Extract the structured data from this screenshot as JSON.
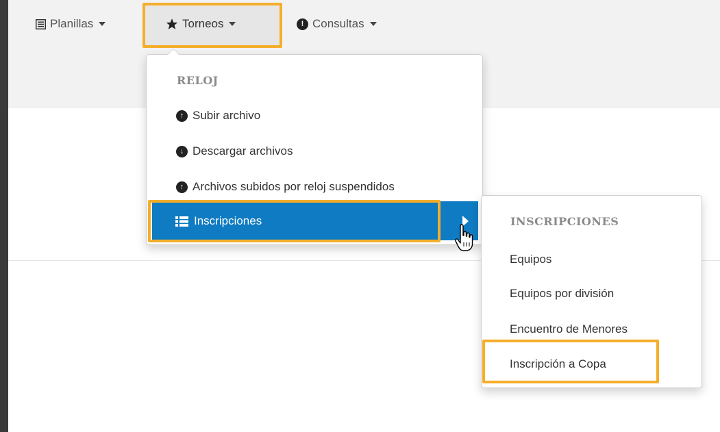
{
  "nav": {
    "planillas": {
      "label": "Planillas",
      "icon": "list-box-icon"
    },
    "torneos": {
      "label": "Torneos",
      "icon": "star-icon"
    },
    "consultas": {
      "label": "Consultas",
      "icon": "exclamation-circle-icon"
    }
  },
  "dropdown": {
    "header": "RELOJ",
    "items": [
      {
        "label": "Subir archivo",
        "icon": "upload-circle-icon"
      },
      {
        "label": "Descargar archivos",
        "icon": "download-circle-icon"
      },
      {
        "label": "Archivos subidos por reloj suspendidos",
        "icon": "upload-circle-icon"
      }
    ],
    "active": {
      "label": "Inscripciones",
      "icon": "list-icon"
    }
  },
  "submenu": {
    "header": "INSCRIPCIONES",
    "items": [
      {
        "label": "Equipos"
      },
      {
        "label": "Equipos por división"
      },
      {
        "label": "Encuentro de Menores"
      },
      {
        "label": "Inscripción a Copa"
      }
    ]
  },
  "colors": {
    "accent_blue": "#0e7bc2",
    "highlight_orange": "#f5ae2b",
    "frame_dark": "#3a3a3a"
  }
}
